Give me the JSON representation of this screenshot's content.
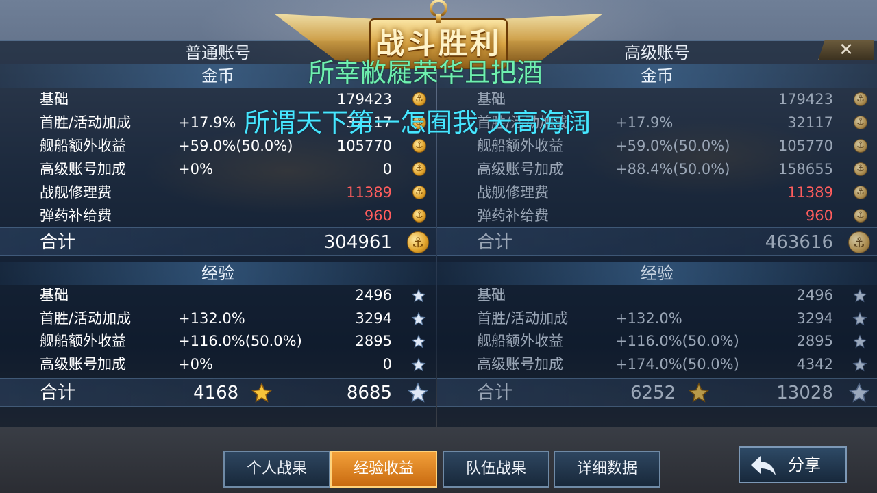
{
  "title": "战斗胜利",
  "overlay_lines": [
    "所幸敝屣荣华且把酒",
    "所谓天下第一怎囿我 天高海阔"
  ],
  "close_label": "✕",
  "accounts": [
    {
      "name": "普通账号",
      "gold_header": "金币",
      "gold_rows": [
        {
          "label": "基础",
          "pct": "",
          "value": "179423",
          "red": false
        },
        {
          "label": "首胜/活动加成",
          "pct": "+17.9%",
          "value": "32117",
          "red": false
        },
        {
          "label": "舰船额外收益",
          "pct": "+59.0%(50.0%)",
          "value": "105770",
          "red": false
        },
        {
          "label": "高级账号加成",
          "pct": "+0%",
          "value": "0",
          "red": false
        },
        {
          "label": "战舰修理费",
          "pct": "",
          "value": "11389",
          "red": true
        },
        {
          "label": "弹药补给费",
          "pct": "",
          "value": "960",
          "red": true
        }
      ],
      "gold_total_label": "合计",
      "gold_total": "304961",
      "exp_header": "经验",
      "exp_rows": [
        {
          "label": "基础",
          "pct": "",
          "value": "2496"
        },
        {
          "label": "首胜/活动加成",
          "pct": "+132.0%",
          "value": "3294"
        },
        {
          "label": "舰船额外收益",
          "pct": "+116.0%(50.0%)",
          "value": "2895"
        },
        {
          "label": "高级账号加成",
          "pct": "+0%",
          "value": "0"
        }
      ],
      "exp_total_label": "合计",
      "exp_total_captain": "4168",
      "exp_total": "8685"
    },
    {
      "name": "高级账号",
      "gold_header": "金币",
      "gold_rows": [
        {
          "label": "基础",
          "pct": "",
          "value": "179423",
          "red": false
        },
        {
          "label": "首胜/活动加成",
          "pct": "+17.9%",
          "value": "32117",
          "red": false
        },
        {
          "label": "舰船额外收益",
          "pct": "+59.0%(50.0%)",
          "value": "105770",
          "red": false
        },
        {
          "label": "高级账号加成",
          "pct": "+88.4%(50.0%)",
          "value": "158655",
          "red": false
        },
        {
          "label": "战舰修理费",
          "pct": "",
          "value": "11389",
          "red": true
        },
        {
          "label": "弹药补给费",
          "pct": "",
          "value": "960",
          "red": true
        }
      ],
      "gold_total_label": "合计",
      "gold_total": "463616",
      "exp_header": "经验",
      "exp_rows": [
        {
          "label": "基础",
          "pct": "",
          "value": "2496"
        },
        {
          "label": "首胜/活动加成",
          "pct": "+132.0%",
          "value": "3294"
        },
        {
          "label": "舰船额外收益",
          "pct": "+116.0%(50.0%)",
          "value": "2895"
        },
        {
          "label": "高级账号加成",
          "pct": "+174.0%(50.0%)",
          "value": "4342"
        }
      ],
      "exp_total_label": "合计",
      "exp_total_captain": "6252",
      "exp_total": "13028"
    }
  ],
  "tabs": [
    {
      "label": "个人战果",
      "active": false
    },
    {
      "label": "经验收益",
      "active": true
    },
    {
      "label": "队伍战果",
      "active": false
    },
    {
      "label": "详细数据",
      "active": false
    }
  ],
  "share_label": "分享",
  "icons": {
    "gold": "anchor-coin-icon",
    "exp": "star-icon",
    "captain_exp": "gold-star-icon",
    "share": "share-arrow-icon",
    "close": "close-icon"
  },
  "colors": {
    "penalty": "#ff5d5d",
    "active_tab": "#f2a03a",
    "overlay_green": "#6ff0b0",
    "overlay_cyan": "#46e6ff"
  }
}
